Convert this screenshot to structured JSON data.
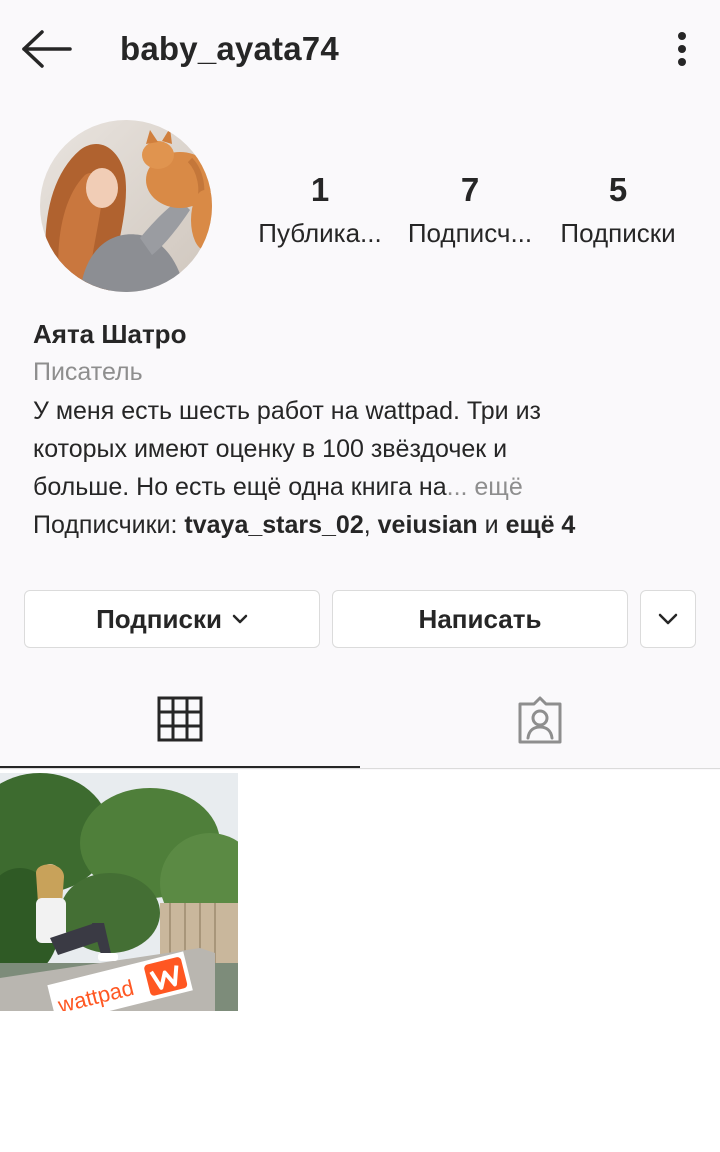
{
  "header": {
    "username": "baby_ayata74",
    "back_icon": "arrow-left-icon",
    "more_icon": "more-vertical-icon"
  },
  "stats": [
    {
      "value": "1",
      "label": "Публика..."
    },
    {
      "value": "7",
      "label": "Подписч..."
    },
    {
      "value": "5",
      "label": "Подписки"
    }
  ],
  "bio": {
    "name": "Аята Шатро",
    "category": "Писатель",
    "line1": "У меня есть шесть работ на wattpad. Три из",
    "line2": "которых имеют оценку в 100 звёздочек и",
    "line3": "больше. Но есть ещё одна книга на",
    "more": "... ещё",
    "followers_prefix": "Подписчики: ",
    "follower1": "tvaya_stars_02",
    "comma": ", ",
    "follower2": "veiusian",
    "and": " и ",
    "others": "ещё 4"
  },
  "buttons": {
    "following": "Подписки",
    "message": "Написать"
  },
  "tabs": {
    "grid_icon": "grid-icon",
    "tagged_icon": "tagged-person-icon"
  },
  "posts": [
    {
      "overlay_text": "wattpad"
    }
  ],
  "colors": {
    "background": "#faf9fb",
    "text": "#262626",
    "secondary": "#8e8e8e",
    "border": "#dbdbdb",
    "wattpad": "#ff5722"
  }
}
